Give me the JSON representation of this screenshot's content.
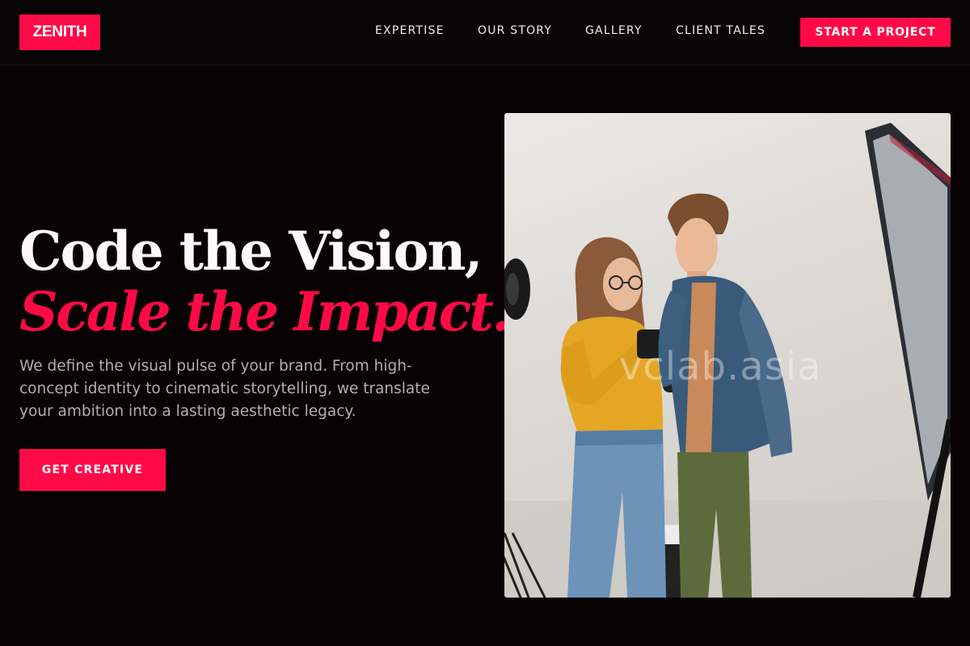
{
  "brand": {
    "name": "ZENITH",
    "accent": "#ff0a46"
  },
  "nav": {
    "items": [
      {
        "label": "EXPERTISE"
      },
      {
        "label": "OUR STORY"
      },
      {
        "label": "GALLERY"
      },
      {
        "label": "CLIENT TALES"
      }
    ],
    "cta_label": "START A PROJECT"
  },
  "hero": {
    "headline_line1": "Code the Vision,",
    "headline_line2": "Scale the Impact.",
    "description": "We define the visual pulse of your brand. From high-concept identity to cinematic storytelling, we translate your ambition into a lasting aesthetic legacy.",
    "cta_label": "GET CREATIVE"
  },
  "photo": {
    "watermark": "vclab.asia"
  }
}
